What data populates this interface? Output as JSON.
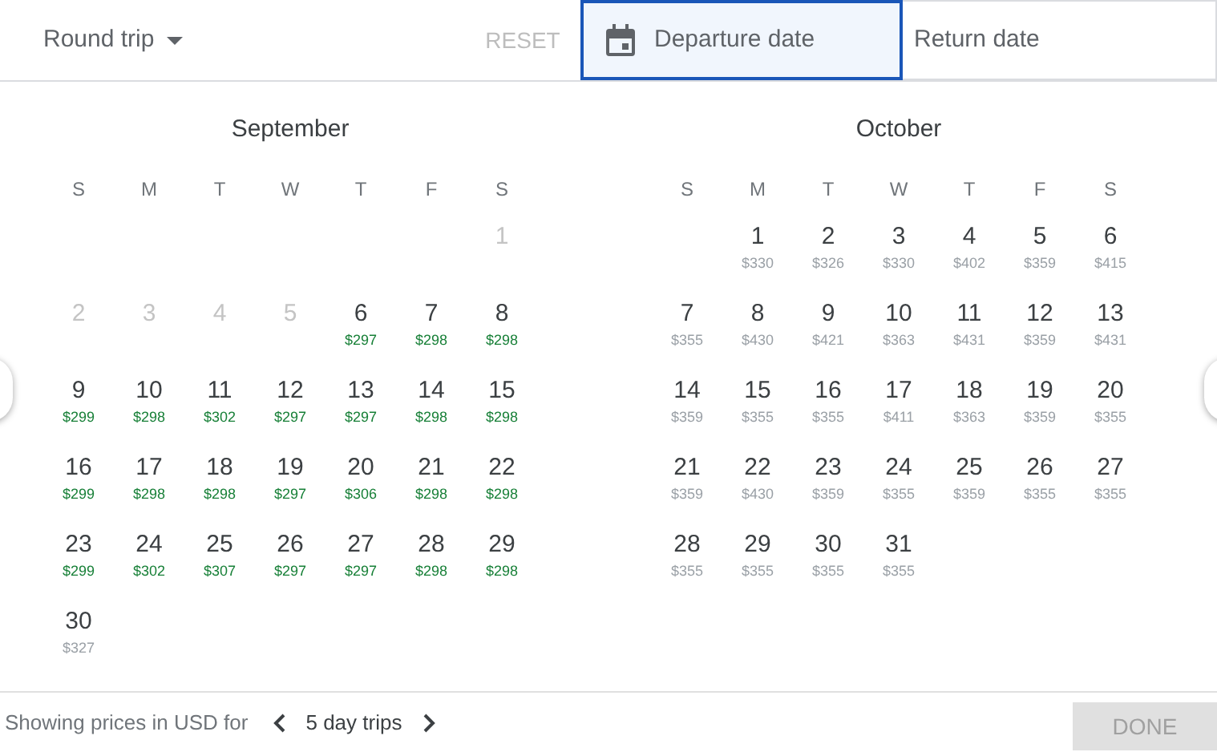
{
  "trip_type": {
    "label": "Round trip"
  },
  "reset_button": {
    "label": "RESET",
    "disabled": true
  },
  "date_fields": [
    {
      "label": "Departure date",
      "selected": true,
      "kind": "icon"
    },
    {
      "label": "Return date",
      "selected": false,
      "kind": "plain"
    }
  ],
  "months": [
    {
      "name": "September",
      "weekdays": [
        "S",
        "M",
        "T",
        "W",
        "T",
        "F",
        "S"
      ],
      "weeks": [
        [
          {
            "kind": "blank"
          },
          {
            "kind": "blank"
          },
          {
            "kind": "blank"
          },
          {
            "kind": "blank"
          },
          {
            "kind": "blank"
          },
          {
            "kind": "blank"
          },
          {
            "day": "1",
            "disabled": true
          }
        ],
        [
          {
            "day": "2",
            "disabled": true
          },
          {
            "day": "3",
            "disabled": true
          },
          {
            "day": "4",
            "disabled": true
          },
          {
            "day": "5",
            "disabled": true
          },
          {
            "day": "6",
            "price": "$297",
            "cheap": true
          },
          {
            "day": "7",
            "price": "$298",
            "cheap": true
          },
          {
            "day": "8",
            "price": "$298",
            "cheap": true
          }
        ],
        [
          {
            "day": "9",
            "price": "$299",
            "cheap": true
          },
          {
            "day": "10",
            "price": "$298",
            "cheap": true
          },
          {
            "day": "11",
            "price": "$302",
            "cheap": true
          },
          {
            "day": "12",
            "price": "$297",
            "cheap": true
          },
          {
            "day": "13",
            "price": "$297",
            "cheap": true
          },
          {
            "day": "14",
            "price": "$298",
            "cheap": true
          },
          {
            "day": "15",
            "price": "$298",
            "cheap": true
          }
        ],
        [
          {
            "day": "16",
            "price": "$299",
            "cheap": true
          },
          {
            "day": "17",
            "price": "$298",
            "cheap": true
          },
          {
            "day": "18",
            "price": "$298",
            "cheap": true
          },
          {
            "day": "19",
            "price": "$297",
            "cheap": true
          },
          {
            "day": "20",
            "price": "$306",
            "cheap": true
          },
          {
            "day": "21",
            "price": "$298",
            "cheap": true
          },
          {
            "day": "22",
            "price": "$298",
            "cheap": true
          }
        ],
        [
          {
            "day": "23",
            "price": "$299",
            "cheap": true
          },
          {
            "day": "24",
            "price": "$302",
            "cheap": true
          },
          {
            "day": "25",
            "price": "$307",
            "cheap": true
          },
          {
            "day": "26",
            "price": "$297",
            "cheap": true
          },
          {
            "day": "27",
            "price": "$297",
            "cheap": true
          },
          {
            "day": "28",
            "price": "$298",
            "cheap": true
          },
          {
            "day": "29",
            "price": "$298",
            "cheap": true
          }
        ],
        [
          {
            "day": "30",
            "price": "$327",
            "cheap": false
          }
        ]
      ]
    },
    {
      "name": "October",
      "weekdays": [
        "S",
        "M",
        "T",
        "W",
        "T",
        "F",
        "S"
      ],
      "weeks": [
        [
          {
            "kind": "blank"
          },
          {
            "day": "1",
            "price": "$330",
            "cheap": false
          },
          {
            "day": "2",
            "price": "$326",
            "cheap": false
          },
          {
            "day": "3",
            "price": "$330",
            "cheap": false
          },
          {
            "day": "4",
            "price": "$402",
            "cheap": false
          },
          {
            "day": "5",
            "price": "$359",
            "cheap": false
          },
          {
            "day": "6",
            "price": "$415",
            "cheap": false
          }
        ],
        [
          {
            "day": "7",
            "price": "$355",
            "cheap": false
          },
          {
            "day": "8",
            "price": "$430",
            "cheap": false
          },
          {
            "day": "9",
            "price": "$421",
            "cheap": false
          },
          {
            "day": "10",
            "price": "$363",
            "cheap": false
          },
          {
            "day": "11",
            "price": "$431",
            "cheap": false
          },
          {
            "day": "12",
            "price": "$359",
            "cheap": false
          },
          {
            "day": "13",
            "price": "$431",
            "cheap": false
          }
        ],
        [
          {
            "day": "14",
            "price": "$359",
            "cheap": false
          },
          {
            "day": "15",
            "price": "$355",
            "cheap": false
          },
          {
            "day": "16",
            "price": "$355",
            "cheap": false
          },
          {
            "day": "17",
            "price": "$411",
            "cheap": false
          },
          {
            "day": "18",
            "price": "$363",
            "cheap": false
          },
          {
            "day": "19",
            "price": "$359",
            "cheap": false
          },
          {
            "day": "20",
            "price": "$355",
            "cheap": false
          }
        ],
        [
          {
            "day": "21",
            "price": "$359",
            "cheap": false
          },
          {
            "day": "22",
            "price": "$430",
            "cheap": false
          },
          {
            "day": "23",
            "price": "$359",
            "cheap": false
          },
          {
            "day": "24",
            "price": "$355",
            "cheap": false
          },
          {
            "day": "25",
            "price": "$359",
            "cheap": false
          },
          {
            "day": "26",
            "price": "$355",
            "cheap": false
          },
          {
            "day": "27",
            "price": "$355",
            "cheap": false
          }
        ],
        [
          {
            "day": "28",
            "price": "$355",
            "cheap": false
          },
          {
            "day": "29",
            "price": "$355",
            "cheap": false
          },
          {
            "day": "30",
            "price": "$355",
            "cheap": false
          },
          {
            "day": "31",
            "price": "$355",
            "cheap": false
          }
        ]
      ]
    }
  ],
  "footer": {
    "note": "Showing prices in USD for",
    "trip_length": "5 day trips",
    "done_button": {
      "label": "DONE",
      "disabled": true
    }
  }
}
